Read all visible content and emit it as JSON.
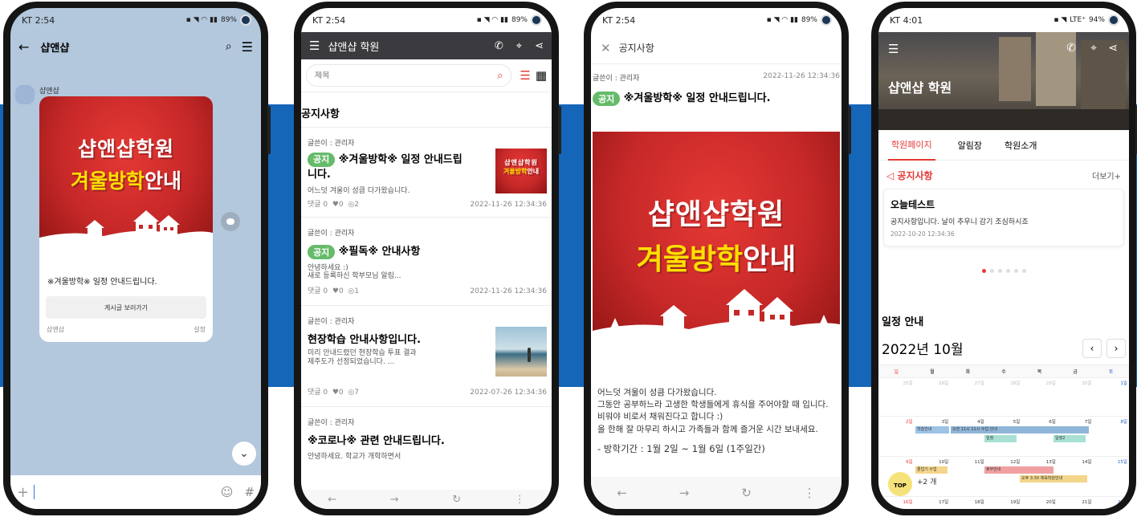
{
  "poster": {
    "line1": "샵앤샵학원",
    "line2_yellow": "겨울방학",
    "line2_white": "안내"
  },
  "phone1": {
    "status": {
      "carrier_time": "KT 2:54",
      "battery": "89%"
    },
    "header": {
      "title": "샵앤샵"
    },
    "sender": "샵앤샵",
    "card": {
      "title": "※겨울방학※ 일정 안내드립니다.",
      "button": "게시글 보러가기",
      "footer_name": "샵앤샵",
      "footer_setting": "설정"
    }
  },
  "phone2": {
    "status": {
      "carrier_time": "KT 2:54",
      "battery": "89%"
    },
    "header": {
      "title": "샵앤샵 학원"
    },
    "search": {
      "placeholder": "제목"
    },
    "section_title": "공지사항",
    "posts": [
      {
        "author": "글쓴이 : 관리자",
        "tag": "공지",
        "title": "※겨울방학※ 일정 안내드립니다.",
        "excerpt": "어느덧 겨울이 성큼 다가왔습니다.",
        "comments": "댓글 0",
        "likes": "0",
        "views": "2",
        "date": "2022-11-26 12:34:36"
      },
      {
        "author": "글쓴이 : 관리자",
        "tag": "공지",
        "title": "※필독※ 안내사항",
        "excerpt": "안녕하세요 :)\n새로 등록하신 학부모님 알림...",
        "comments": "댓글 0",
        "likes": "0",
        "views": "1",
        "date": "2022-11-26 12:34:36"
      },
      {
        "author": "글쓴이 : 관리자",
        "tag": "",
        "title": "현장학습 안내사항입니다.",
        "excerpt": "미리 안내드렸던 현장학습 투표 결과\n제주도가 선정되었습니다. ...",
        "comments": "댓글 0",
        "likes": "0",
        "views": "7",
        "date": "2022-07-26 12:34:36"
      },
      {
        "author": "글쓴이 : 관리자",
        "tag": "",
        "title": "※코로나※ 관련 안내드립니다.",
        "excerpt": "안녕하세요. 학교가 개학하면서",
        "comments": "",
        "likes": "",
        "views": "",
        "date": ""
      }
    ]
  },
  "phone3": {
    "status": {
      "carrier_time": "KT 2:54",
      "battery": "89%"
    },
    "header": {
      "title": "공지사항"
    },
    "author": "글쓴이 : 관리자",
    "date": "2022-11-26 12:34:36",
    "tag": "공지",
    "title": "※겨울방학※ 일정 안내드립니다.",
    "body": [
      "어느덧 겨울이 성큼 다가왔습니다.",
      "그동안 공부하느라 고생한 학생들에게 휴식을 주어야할 때 입니다. 비워야 비로서 채워진다고 합니다 :)",
      "올 한해 잘 마무리 하시고 가족들과 함께 즐거운 시간 보내세요."
    ],
    "period": "- 방학기간 : 1월 2일 ~ 1월 6일 (1주일간)"
  },
  "phone4": {
    "status": {
      "carrier_time": "KT 4:01",
      "network": "LTE⁺",
      "battery": "94%"
    },
    "header": {
      "title": "샵앤샵 학원"
    },
    "tabs": [
      "학원페이지",
      "알림장",
      "학원소개"
    ],
    "notice": {
      "title": "공지사항",
      "more": "더보기+",
      "card_title": "오늘테스트",
      "card_text": "공지사항입니다. 날이 추우니 감기 조심하시죠",
      "card_date": "2022-10-20 12:34:36"
    },
    "schedule": {
      "title": "일정 안내",
      "month": "2022년 10월",
      "weekdays": [
        "일",
        "월",
        "화",
        "수",
        "목",
        "금",
        "토"
      ],
      "row1": [
        "25일",
        "26일",
        "27일",
        "28일",
        "29일",
        "30일",
        "1일"
      ],
      "row2": [
        "2일",
        "3일",
        "4일",
        "5일",
        "6일",
        "7일",
        "8일"
      ],
      "row3": [
        "9일",
        "10일",
        "11일",
        "12일",
        "13일",
        "14일",
        "15일"
      ],
      "row4": [
        "16일",
        "17일",
        "18일",
        "19일",
        "20일",
        "21일",
        "22일"
      ],
      "events": {
        "e1": "학습안내",
        "e2": "오전 11시 11시 수업 안내",
        "e3": "일정",
        "e4": "일정2",
        "e5": "졸업기 수업",
        "e6": "+2 개",
        "e7": "휴무안내",
        "e8": "오후 3:30 체육학원안내"
      },
      "top_button": "TOP"
    }
  }
}
